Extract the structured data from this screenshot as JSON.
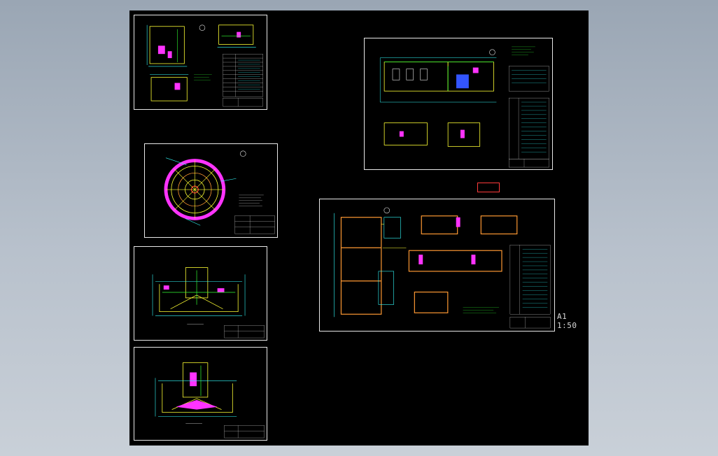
{
  "viewer": {
    "scale_label": "A1 1:50"
  },
  "sheets": [
    {
      "id": "sheet-1",
      "kind": "plan-section-table"
    },
    {
      "id": "sheet-2",
      "kind": "circular-plan"
    },
    {
      "id": "sheet-3",
      "kind": "section"
    },
    {
      "id": "sheet-4",
      "kind": "section"
    },
    {
      "id": "sheet-5",
      "kind": "building-plan-table"
    },
    {
      "id": "sheet-6",
      "kind": "tank-plan-table"
    }
  ],
  "colors": {
    "background": "#000000",
    "border": "#e8e8e8",
    "yellow": "#ffff33",
    "cyan": "#33ffff",
    "magenta": "#ff33ff",
    "red": "#ff3333",
    "green": "#33ff33",
    "blue": "#3355ff",
    "orange": "#ff9933"
  }
}
